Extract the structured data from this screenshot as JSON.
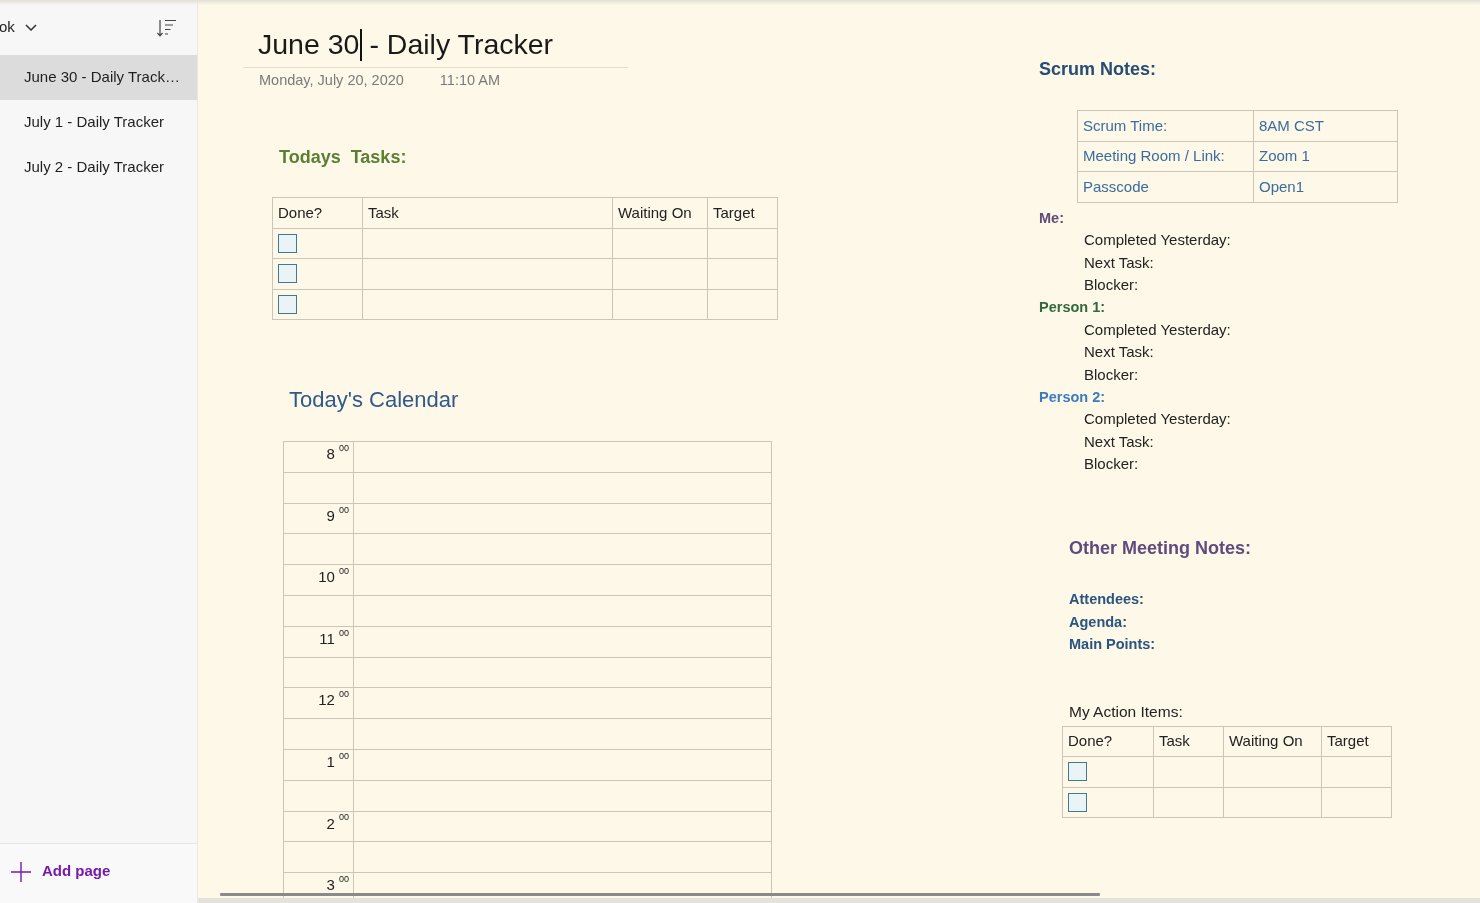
{
  "sidebar": {
    "notebook_name": "ok",
    "pages": [
      {
        "title": "June 30 - Daily Track…",
        "selected": true
      },
      {
        "title": "July 1 - Daily Tracker",
        "selected": false
      },
      {
        "title": "July 2 - Daily Tracker",
        "selected": false
      }
    ],
    "add_page": "Add page"
  },
  "page": {
    "title_before_cursor": "June 30",
    "title_after_cursor": "- Daily Tracker",
    "date": "Monday, July 20, 2020",
    "time": "11:10 AM"
  },
  "tasks": {
    "heading": "Todays  Tasks:",
    "columns": [
      "Done?",
      "Task",
      "Waiting On",
      "Target"
    ],
    "rows": [
      {
        "done": false
      },
      {
        "done": false
      },
      {
        "done": false
      }
    ]
  },
  "calendar": {
    "heading": "Today's Calendar",
    "hours": [
      "8 $^{00}$",
      "9 $^{00}$",
      "10 $^{00}$",
      "11 $^{00}$",
      "12 $^{00}$",
      "1 $^{00}$",
      "2 $^{00}$",
      "3 $^{00}$"
    ]
  },
  "scrum": {
    "heading": "Scrum Notes:",
    "info": [
      {
        "label": "Scrum Time:",
        "value": "8AM CST"
      },
      {
        "label": "Meeting Room / Link:",
        "value": "Zoom 1"
      },
      {
        "label": "Passcode",
        "value": "Open1"
      }
    ],
    "people": [
      {
        "name": "Me:",
        "color": "#604a7b",
        "fields": [
          "Completed Yesterday:",
          "Next Task:",
          "Blocker:"
        ]
      },
      {
        "name": "Person 1:",
        "color": "#31693c",
        "fields": [
          "Completed Yesterday:",
          "Next Task:",
          "Blocker:"
        ]
      },
      {
        "name": "Person 2:",
        "color": "#3b7bbf",
        "fields": [
          "Completed Yesterday:",
          "Next Task:",
          "Blocker:"
        ]
      }
    ]
  },
  "other_meeting": {
    "heading": "Other Meeting Notes:",
    "fields": [
      "Attendees:",
      "Agenda:",
      "Main Points:"
    ],
    "action_items": {
      "label": "My Action Items:",
      "columns": [
        "Done?",
        "Task",
        "Waiting On",
        "Target"
      ],
      "rows": [
        {
          "done": false
        },
        {
          "done": false
        }
      ]
    }
  }
}
